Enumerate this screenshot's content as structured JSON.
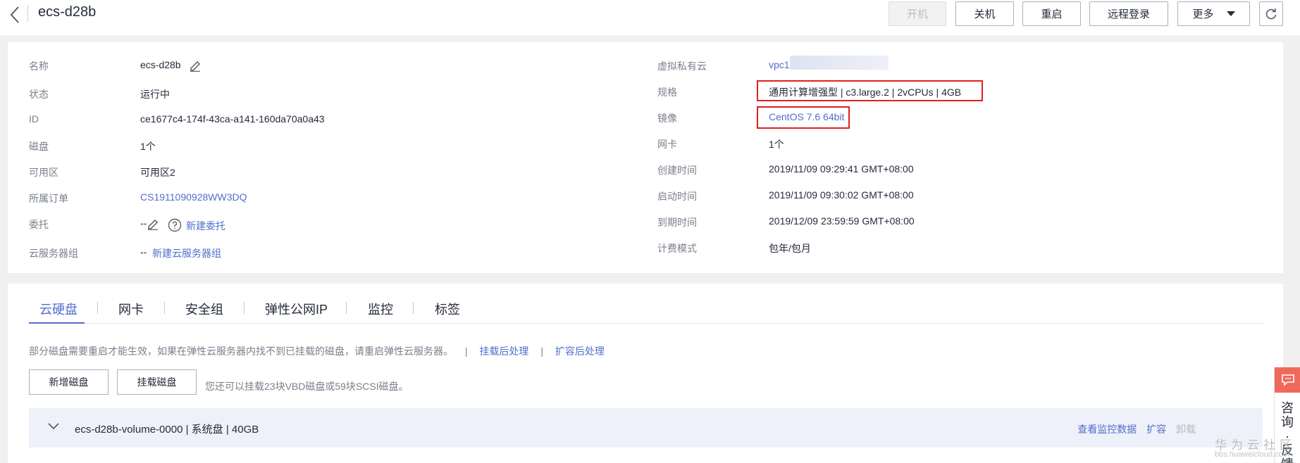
{
  "header": {
    "title": "ecs-d28b",
    "buttons": {
      "power_on": "开机",
      "power_off": "关机",
      "restart": "重启",
      "remote_login": "远程登录",
      "more": "更多"
    }
  },
  "info": {
    "left": [
      {
        "label": "名称",
        "value": "ecs-d28b"
      },
      {
        "label": "状态",
        "value": "运行中"
      },
      {
        "label": "ID",
        "value": "ce1677c4-174f-43ca-a141-160da70a0a43"
      },
      {
        "label": "磁盘",
        "value": "1个"
      },
      {
        "label": "可用区",
        "value": "可用区2"
      },
      {
        "label": "所属订单",
        "value": "CS1911090928WW3DQ"
      },
      {
        "label": "委托",
        "value": "--",
        "link": "新建委托"
      },
      {
        "label": "云服务器组",
        "value": "--",
        "link": "新建云服务器组"
      }
    ],
    "right": [
      {
        "label": "虚拟私有云",
        "value": "vpc1"
      },
      {
        "label": "规格",
        "value": "通用计算增强型 | c3.large.2 | 2vCPUs | 4GB"
      },
      {
        "label": "镜像",
        "value": "CentOS 7.6 64bit"
      },
      {
        "label": "网卡",
        "value": "1个"
      },
      {
        "label": "创建时间",
        "value": "2019/11/09 09:29:41 GMT+08:00"
      },
      {
        "label": "启动时间",
        "value": "2019/11/09 09:30:02 GMT+08:00"
      },
      {
        "label": "到期时间",
        "value": "2019/12/09 23:59:59 GMT+08:00"
      },
      {
        "label": "计费模式",
        "value": "包年/包月"
      }
    ]
  },
  "tabs": [
    "云硬盘",
    "网卡",
    "安全组",
    "弹性公网IP",
    "监控",
    "标签"
  ],
  "disk_section": {
    "notice": "部分磁盘需要重启才能生效，如果在弹性云服务器内找不到已挂载的磁盘，请重启弹性云服务器。",
    "links": [
      "挂载后处理",
      "扩容后处理"
    ],
    "separator": "|",
    "add_button": "新增磁盘",
    "attach_button": "挂载磁盘",
    "quota_text": "您还可以挂载23块VBD磁盘或59块SCSI磁盘。",
    "disks": [
      {
        "name": "ecs-d28b-volume-0000",
        "detail": " | 系统盘 | 40GB",
        "actions": [
          "查看监控数据",
          "扩容",
          "卸载"
        ]
      }
    ]
  },
  "side": {
    "feedback": "咨询·反馈"
  },
  "watermark": {
    "brand": "华为云社区",
    "url": "bbs.huaweicloud.com"
  },
  "colors": {
    "accent": "#526ecc",
    "highlight": "#e02020",
    "side_accent": "#f06a5c"
  }
}
